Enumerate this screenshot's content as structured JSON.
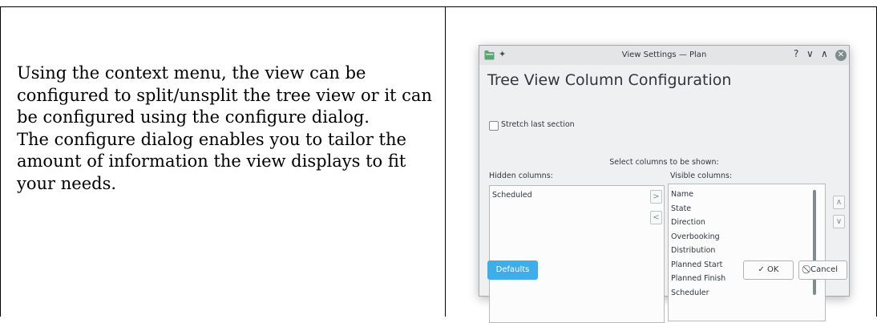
{
  "doc": {
    "paragraph1": "Using the context menu, the view can be configured to split/unsplit the tree view or it can be configured using the configure dialog.",
    "paragraph2": "The configure dialog enables you to tailor the amount of information the view displays to fit your needs."
  },
  "window": {
    "title": "View Settings — Plan",
    "help": "?",
    "minimize": "∨",
    "maximize": "∧",
    "close": "✕",
    "pin": "✦"
  },
  "dialog": {
    "heading": "Tree View Column Configuration",
    "stretch_label": "Stretch last section",
    "stretch_checked": false,
    "select_label": "Select columns to be shown:",
    "hidden_label": "Hidden columns:",
    "visible_label": "Visible columns:",
    "hidden_columns": [
      "Scheduled"
    ],
    "visible_columns": [
      "Name",
      "State",
      "Direction",
      "Overbooking",
      "Distribution",
      "Planned Start",
      "Planned Finish",
      "Scheduler"
    ],
    "move_right": ">",
    "move_left": "<",
    "move_up": "∧",
    "move_down": "∨",
    "defaults_label": "Defaults",
    "ok_label": "✓ OK",
    "cancel_label": "⃠ Cancel"
  },
  "colors": {
    "accent": "#3daee9",
    "window_bg": "#eff0f1",
    "text": "#31363b"
  }
}
